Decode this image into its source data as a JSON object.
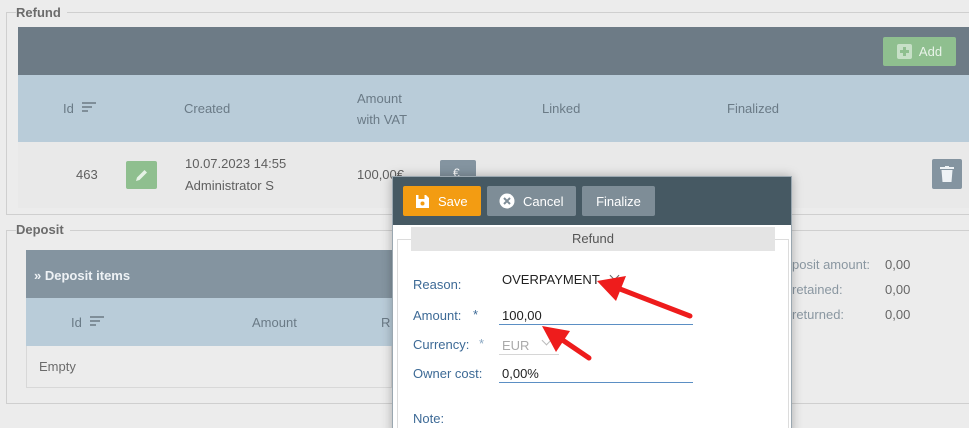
{
  "refund_section": {
    "title": "Refund",
    "add_label": "Add",
    "columns": {
      "id": "Id",
      "created": "Created",
      "amount_line1": "Amount",
      "amount_line2": "with VAT",
      "linked": "Linked",
      "finalized": "Finalized"
    },
    "rows": [
      {
        "id": "463",
        "created_date": "10.07.2023 14:55",
        "created_by": "Administrator S",
        "amount": "100,00€",
        "link_label": "€"
      }
    ]
  },
  "deposit_section": {
    "title": "Deposit",
    "panel_title": "» Deposit items",
    "columns": {
      "id": "Id",
      "amount": "Amount",
      "third": "R"
    },
    "empty_text": "Empty",
    "summary": [
      {
        "label": "posit amount:",
        "value": "0,00"
      },
      {
        "label": "retained:",
        "value": "0,00"
      },
      {
        "label": "returned:",
        "value": "0,00"
      }
    ]
  },
  "modal": {
    "buttons": {
      "save": "Save",
      "cancel": "Cancel",
      "finalize": "Finalize"
    },
    "tab": "Refund",
    "fields": {
      "reason_label": "Reason:",
      "reason_value": "OVERPAYMENT",
      "amount_label": "Amount:",
      "amount_value": "100,00",
      "currency_label": "Currency:",
      "currency_value": "EUR",
      "owner_cost_label": "Owner cost:",
      "owner_cost_value": "0,00%",
      "note_label": "Note:",
      "required_mark": "*"
    }
  },
  "annotation": {
    "arrow_color": "#ee1c1c",
    "arrow_count": 2
  },
  "colors": {
    "dark_toolbar": "#6d7b86",
    "header_row": "#b9ccd9",
    "save_orange": "#f39c12",
    "green_action": "#8fbf8f",
    "label_blue": "#3d6a96"
  }
}
